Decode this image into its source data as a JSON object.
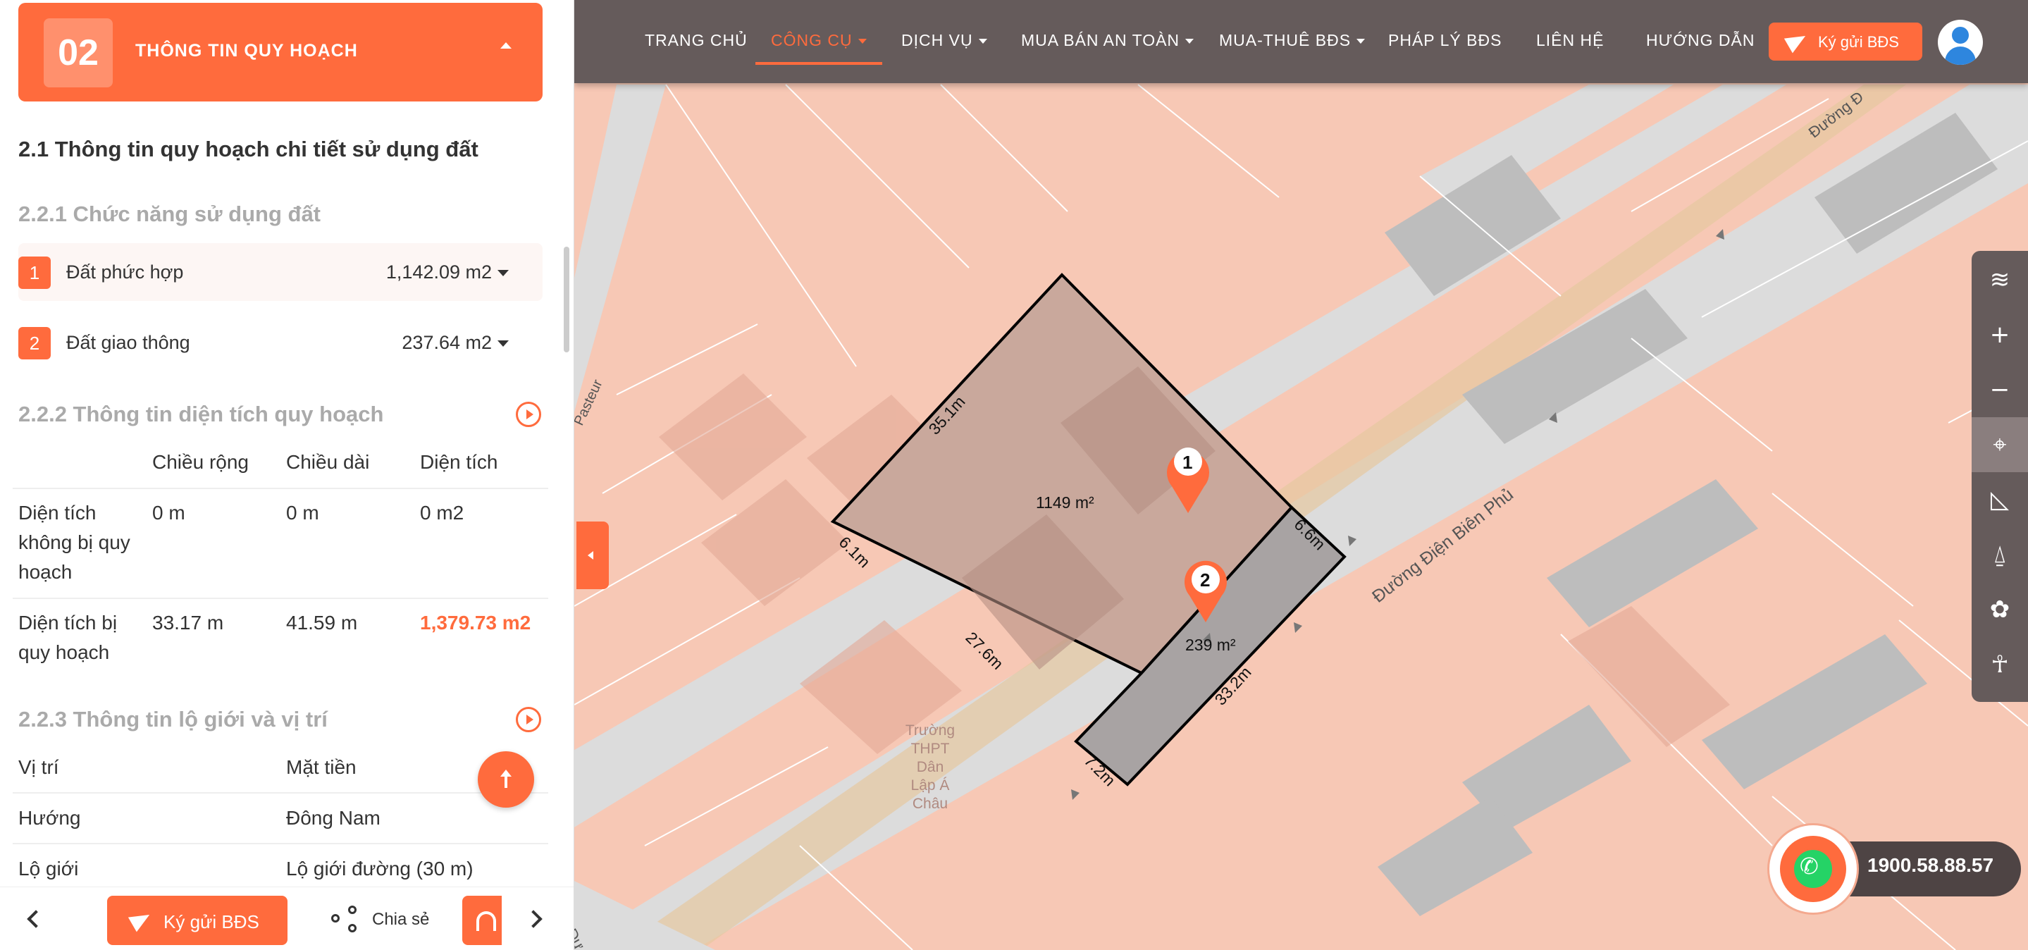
{
  "panel": {
    "number": "02",
    "title": "THÔNG TIN QUY HOẠCH",
    "section_title": "2.1 Thông tin quy hoạch chi tiết sử dụng đất",
    "land_use": {
      "heading": "2.2.1 Chức năng sử dụng đất",
      "items": [
        {
          "index": "1",
          "name": "Đất phức hợp",
          "area": "1,142.09 m2"
        },
        {
          "index": "2",
          "name": "Đất giao thông",
          "area": "237.64 m2"
        }
      ]
    },
    "area_info": {
      "heading": "2.2.2 Thông tin diện tích quy hoạch",
      "columns": [
        "Chiều rộng",
        "Chiều dài",
        "Diện tích"
      ],
      "rows": [
        {
          "label": [
            "Diện tích",
            "không bị quy",
            "hoạch"
          ],
          "width": "0 m",
          "length": "0 m",
          "area": "0 m2"
        },
        {
          "label": [
            "Diện tích bị",
            "quy hoạch"
          ],
          "width": "33.17 m",
          "length": "41.59 m",
          "area": "1,379.73 m2"
        }
      ]
    },
    "road_info": {
      "heading": "2.2.3 Thông tin lộ giới và vị trí",
      "rows": [
        {
          "label": "Vị trí",
          "value": "Mặt tiền"
        },
        {
          "label": "Hướng",
          "value": "Đông Nam"
        },
        {
          "label": "Lộ giới",
          "value": "Lộ giới đường (30 m)"
        }
      ]
    },
    "footer": {
      "kygui_label": "Ký gửi BĐS",
      "share_label": "Chia sẻ"
    }
  },
  "nav": {
    "items": [
      {
        "label": "TRANG CHỦ",
        "dropdown": false,
        "active": false
      },
      {
        "label": "CÔNG CỤ",
        "dropdown": true,
        "active": true
      },
      {
        "label": "DỊCH VỤ",
        "dropdown": true,
        "active": false
      },
      {
        "label": "MUA BÁN AN TOÀN",
        "dropdown": true,
        "active": false
      },
      {
        "label": "MUA-THUÊ BĐS",
        "dropdown": true,
        "active": false
      },
      {
        "label": "PHÁP LÝ BĐS",
        "dropdown": false,
        "active": false
      },
      {
        "label": "LIÊN HỆ",
        "dropdown": false,
        "active": false
      },
      {
        "label": "HƯỚNG DẪN",
        "dropdown": false,
        "active": false
      }
    ],
    "kygui_label": "Ký gửi BĐS"
  },
  "map": {
    "parcel_area_1": "1149 m²",
    "parcel_area_2": "239 m²",
    "edge_labels": [
      "35.1m",
      "6.1m",
      "27.6m",
      "7.2m",
      "33.2m",
      "6.6m"
    ],
    "markers": [
      "1",
      "2"
    ],
    "street_main": "Đường Điện Biên Phủ",
    "street_pasteur": "Pasteur",
    "street_top": "Đường Đ",
    "street_bottom": "Đư",
    "school_label": [
      "Trường",
      "THPT",
      "Dân",
      "Lập Á",
      "Châu"
    ]
  },
  "toolbar": {
    "tools": [
      "layers-icon",
      "zoom-in-icon",
      "zoom-out-icon",
      "location-icon",
      "measure-icon",
      "map-pin-icon",
      "palette-icon",
      "street-view-icon"
    ],
    "active": "location-icon"
  },
  "hotline": {
    "number": "1900.58.88.57"
  },
  "colors": {
    "accent": "#ff6b3d",
    "navbar": "#655b5b",
    "map_bg": "#f7c8b5",
    "parcel_fill": "#c9a89c",
    "road_fill": "#a8a3a3"
  }
}
